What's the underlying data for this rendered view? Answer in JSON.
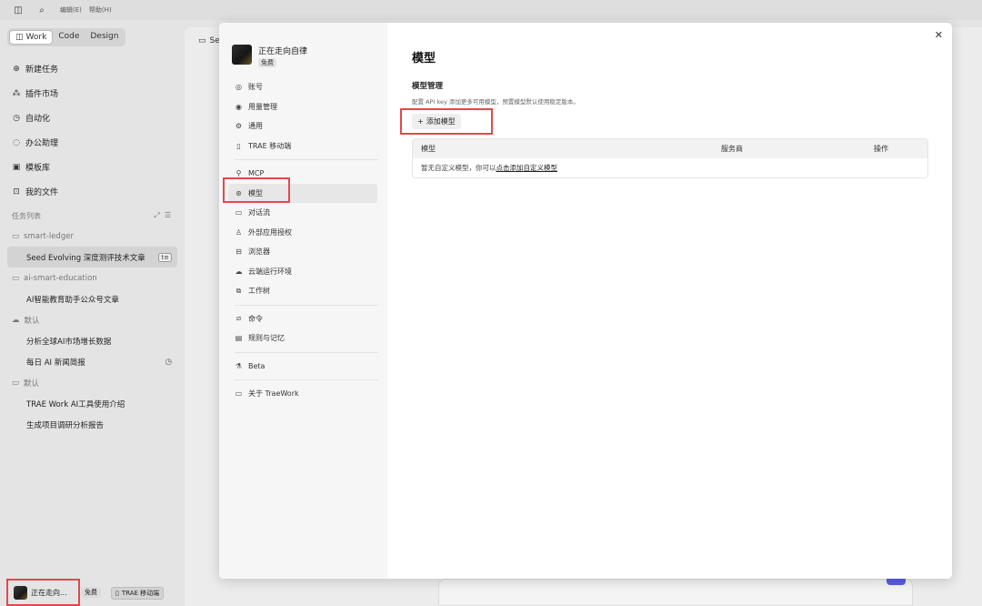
{
  "titlebar": {
    "menu_edit": "编辑(E)",
    "menu_help": "帮助(H)"
  },
  "modes": [
    "Work",
    "Code",
    "Design"
  ],
  "nav": [
    {
      "icon": "plus-circle-icon",
      "glyph": "⊕",
      "label": "新建任务"
    },
    {
      "icon": "plugin-icon",
      "glyph": "⁂",
      "label": "插件市场"
    },
    {
      "icon": "clock-icon",
      "glyph": "◷",
      "label": "自动化"
    },
    {
      "icon": "chat-icon",
      "glyph": "◌",
      "label": "办公助理"
    },
    {
      "icon": "template-icon",
      "glyph": "▣",
      "label": "模板库"
    },
    {
      "icon": "folder-file-icon",
      "glyph": "⊡",
      "label": "我的文件"
    }
  ],
  "tasks_header": "任务列表",
  "tasks": [
    {
      "type": "group",
      "label": "smart-ledger"
    },
    {
      "type": "task",
      "label": "Seed Evolving 深度测评技术文章",
      "selected": true,
      "badge": "t≡"
    },
    {
      "type": "group",
      "label": "ai-smart-education"
    },
    {
      "type": "task",
      "label": "AI智能教育助手公众号文章"
    },
    {
      "type": "group",
      "label": "默认"
    },
    {
      "type": "task",
      "label": "分析全球AI市场增长数据"
    },
    {
      "type": "task",
      "label": "每日 AI 新闻简报",
      "clock": true
    },
    {
      "type": "group",
      "label": "默认"
    },
    {
      "type": "task",
      "label": "TRAE Work AI工具使用介绍"
    },
    {
      "type": "task",
      "label": "生成项目调研分析报告"
    }
  ],
  "user": {
    "name": "正在走向...",
    "plan": "免费",
    "mobile": "TRAE 移动端"
  },
  "background": {
    "header": "Se"
  },
  "modal": {
    "profile_name": "正在走向自律",
    "profile_plan": "免费",
    "nav": [
      {
        "icon": "account-icon",
        "glyph": "◎",
        "label": "账号"
      },
      {
        "icon": "usage-icon",
        "glyph": "◉",
        "label": "用量管理"
      },
      {
        "icon": "settings-icon",
        "glyph": "⚙",
        "label": "通用"
      },
      {
        "icon": "mobile-icon",
        "glyph": "▯",
        "label": "TRAE 移动端"
      },
      {
        "divider": true
      },
      {
        "icon": "mcp-icon",
        "glyph": "⚲",
        "label": "MCP"
      },
      {
        "icon": "model-icon",
        "glyph": "⊛",
        "label": "模型",
        "active": true
      },
      {
        "icon": "conversation-icon",
        "glyph": "▭",
        "label": "对话流"
      },
      {
        "icon": "external-auth-icon",
        "glyph": "♙",
        "label": "外部应用授权"
      },
      {
        "icon": "browser-icon",
        "glyph": "⊟",
        "label": "浏览器"
      },
      {
        "icon": "cloud-icon",
        "glyph": "☁",
        "label": "云端运行环境"
      },
      {
        "icon": "worktree-icon",
        "glyph": "⧉",
        "label": "工作树"
      },
      {
        "divider": true
      },
      {
        "icon": "command-icon",
        "glyph": "⧄",
        "label": "命令"
      },
      {
        "icon": "rules-icon",
        "glyph": "▤",
        "label": "规则与记忆"
      },
      {
        "divider": true
      },
      {
        "icon": "beta-icon",
        "glyph": "⚗",
        "label": "Beta"
      },
      {
        "divider": true
      },
      {
        "icon": "about-icon",
        "glyph": "▭",
        "label": "关于 TraeWork"
      }
    ],
    "title": "模型",
    "section_title": "模型管理",
    "section_desc": "配置 API key 添加更多可用模型，预置模型默认使用稳定版本。",
    "add_button": "添加模型",
    "table_headers": [
      "模型",
      "服务商",
      "操作"
    ],
    "empty_text": "暂无自定义模型，你可以",
    "empty_link": "点击添加自定义模型"
  }
}
